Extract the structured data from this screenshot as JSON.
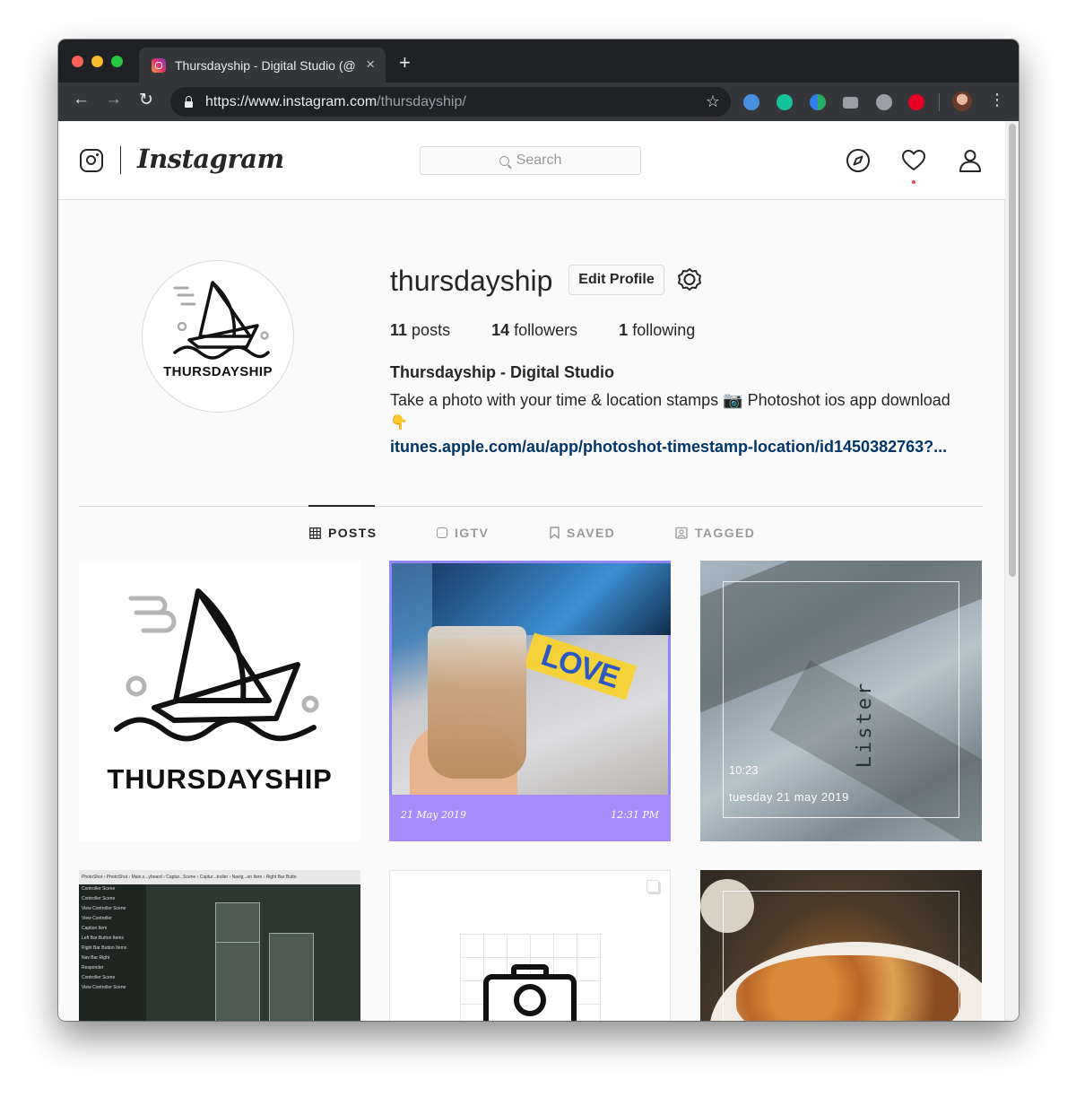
{
  "browser": {
    "tab_title": "Thursdayship - Digital Studio (@",
    "new_tab": "+",
    "tab_close": "×",
    "url_main": "https://www.instagram.com",
    "url_path": "/thursdayship/",
    "icons": {
      "back": "←",
      "forward": "→",
      "reload": "↻",
      "star": "☆",
      "menu": "⋮"
    },
    "extensions": [
      "download-extension-icon",
      "grammarly-extension-icon",
      "color-extension-icon",
      "camera-extension-icon",
      "m-extension-icon",
      "pinterest-extension-icon"
    ]
  },
  "instagram": {
    "wordmark": "Instagram",
    "search_placeholder": "Search",
    "nav_icons": [
      "explore-icon",
      "activity-heart-icon",
      "profile-icon"
    ]
  },
  "profile": {
    "avatar_text": "THURSDAYSHIP",
    "username": "thursdayship",
    "edit_button": "Edit Profile",
    "posts_count": "11",
    "posts_label": "posts",
    "followers_count": "14",
    "followers_label": "followers",
    "following_count": "1",
    "following_label": "following",
    "full_name": "Thursdayship - Digital Studio",
    "bio": "Take a photo with your time & location stamps 📷  Photoshot ios app download",
    "bio_emoji": "👇",
    "link": "itunes.apple.com/au/app/photoshot-timestamp-location/id1450382763?..."
  },
  "tabs": [
    {
      "label": "POSTS",
      "active": true
    },
    {
      "label": "IGTV",
      "active": false
    },
    {
      "label": "SAVED",
      "active": false
    },
    {
      "label": "TAGGED",
      "active": false
    }
  ],
  "posts": {
    "p1": {
      "text": "THURSDAYSHIP"
    },
    "p2": {
      "badge": "LOVE",
      "date": "21 May 2019",
      "time": "12:31 PM"
    },
    "p3": {
      "word": "Lister",
      "time": "10:23",
      "date": "tuesday  21 may 2019"
    },
    "p4": {
      "breadcrumb": "PhotoShot › PhotoShot › Main.s...yboard › Captur...Scene › Captur...troller › Navig...on Item › Right Bar Butto",
      "items": [
        "Controller Scene",
        "Controller Scene",
        "View Controller Scene",
        "View Controller",
        "Caption Item",
        "Left Bar Button Items",
        "Right Bar Button Items",
        "Nav Bar Right",
        "Responder",
        "",
        "Controller Scene",
        "View Controller Scene"
      ]
    }
  },
  "colors": {
    "chrome_dark": "#202124",
    "toolbar": "#35363a",
    "link": "#003569",
    "text": "#262626",
    "border": "#dbdbdb",
    "post2_caption": "#a78bfa"
  }
}
